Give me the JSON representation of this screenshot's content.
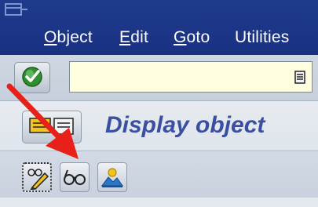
{
  "menubar": {
    "items": [
      {
        "id": "object",
        "hot": "O",
        "rest": "bject"
      },
      {
        "id": "edit",
        "hot": "E",
        "rest": "dit"
      },
      {
        "id": "goto",
        "hot": "G",
        "rest": "oto"
      },
      {
        "id": "utilities",
        "hot": "",
        "rest": "Utilities"
      }
    ]
  },
  "toolbar": {
    "command_field_value": "",
    "enter_icon": "green-check-icon",
    "history_icon": "command-history-icon"
  },
  "title": {
    "text": "Display object",
    "button_icon": "display-change-toggle-icon"
  },
  "app_toolbar": {
    "buttons": [
      "pencil-glasses-icon",
      "glasses-icon",
      "image-icon"
    ]
  },
  "annotation": {
    "arrow_color": "#e8201a"
  },
  "colors": {
    "menubar": "#1f3b8c",
    "title_text": "#3a4fa0",
    "command_field": "#fffde0"
  }
}
